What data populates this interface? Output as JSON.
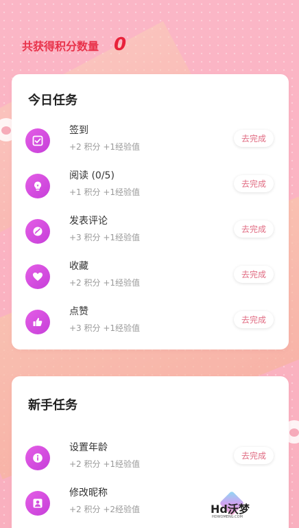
{
  "header": {
    "points_label": "共获得积分数量",
    "points_value": "0"
  },
  "daily_tasks": {
    "title": "今日任务",
    "items": [
      {
        "name": "签到",
        "reward": "+2 积分 +1经验值",
        "action": "去完成",
        "icon": "checkbox-icon"
      },
      {
        "name": "阅读 (0/5)",
        "reward": "+1 积分 +1经验值",
        "action": "去完成",
        "icon": "lightbulb-icon"
      },
      {
        "name": "发表评论",
        "reward": "+3 积分 +1经验值",
        "action": "去完成",
        "icon": "comment-icon"
      },
      {
        "name": "收藏",
        "reward": "+2 积分 +1经验值",
        "action": "去完成",
        "icon": "heart-icon"
      },
      {
        "name": "点赞",
        "reward": "+3 积分 +1经验值",
        "action": "去完成",
        "icon": "thumbs-up-icon"
      }
    ]
  },
  "newbie_tasks": {
    "title": "新手任务",
    "items": [
      {
        "name": "设置年龄",
        "reward": "+2 积分 +1经验值",
        "action": "去完成",
        "icon": "info-icon"
      },
      {
        "name": "修改昵称",
        "reward": "+2 积分 +2经验值",
        "action": "",
        "icon": "user-icon"
      }
    ]
  },
  "watermark": {
    "text": "Hd沃梦",
    "subtext": "HDWOMENG.COM"
  },
  "colors": {
    "accent": "#e8324a",
    "icon_gradient_start": "#e45ee6",
    "icon_gradient_end": "#c63fd9",
    "button_text": "#e06b82",
    "background": "#fbb6c6"
  }
}
